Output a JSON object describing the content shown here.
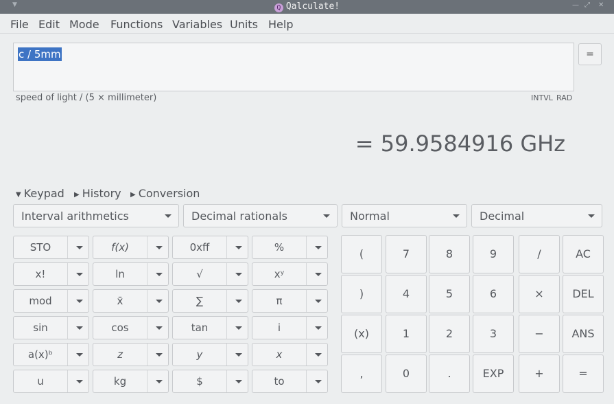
{
  "window": {
    "title": "Qalculate!"
  },
  "menu": [
    "File",
    "Edit",
    "Mode",
    "Functions",
    "Variables",
    "Units",
    "Help"
  ],
  "expression": {
    "value": "c / 5mm"
  },
  "equals_button": "=",
  "parsed": "speed of light  /  (5 × millimeter)",
  "status": {
    "intvl": "INTVL",
    "rad": "RAD"
  },
  "result": "= 59.9584916 GHz",
  "expanders": [
    "Keypad",
    "History",
    "Conversion"
  ],
  "combos": [
    "Interval arithmetics",
    "Decimal rationals",
    "Normal",
    "Decimal"
  ],
  "keypad_rows": [
    [
      "STO",
      "f(x)",
      "0xff",
      "%"
    ],
    [
      "x!",
      "ln",
      "√",
      "xʸ"
    ],
    [
      "mod",
      "x̄",
      "∑",
      "π"
    ],
    [
      "sin",
      "cos",
      "tan",
      "i"
    ],
    [
      "a(x)ᵇ",
      "z",
      "y",
      "x"
    ],
    [
      "u",
      "kg",
      "$",
      "to"
    ]
  ],
  "numpad_rows": [
    [
      "(",
      "7",
      "8",
      "9",
      "/",
      "AC"
    ],
    [
      ")",
      "4",
      "5",
      "6",
      "×",
      "DEL"
    ],
    [
      "(x)",
      "1",
      "2",
      "3",
      "−",
      "ANS"
    ],
    [
      ",",
      "0",
      ".",
      "EXP",
      "+",
      "="
    ]
  ],
  "colors": {
    "titlebar": "#6b7178",
    "selection": "#3e74c4",
    "background": "#eceeef"
  }
}
